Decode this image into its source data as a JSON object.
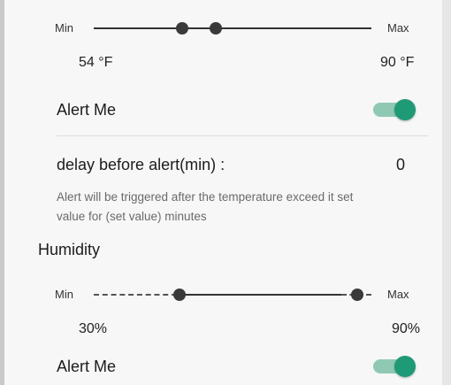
{
  "temperature": {
    "slider": {
      "min_label": "Min",
      "max_label": "Max",
      "low_fraction": 0.32,
      "high_fraction": 0.44
    },
    "min_value": "54 °F",
    "max_value": "90 °F",
    "alert_label": "Alert Me",
    "alert_on": true,
    "delay_label": "delay before alert(min) :",
    "delay_value": "0",
    "hint_line1": "Alert will be triggered after the temperature exceed it set",
    "hint_line2": "value for (set value) minutes"
  },
  "humidity": {
    "title": "Humidity",
    "slider": {
      "min_label": "Min",
      "max_label": "Max",
      "low_fraction": 0.31,
      "high_fraction": 0.95
    },
    "min_value": "30%",
    "max_value": "90%",
    "alert_label": "Alert Me",
    "alert_on": true
  },
  "colors": {
    "toggle_track": "#8fc9b4",
    "toggle_knob": "#1f9a76",
    "slider_thumb": "#3a3a3a"
  }
}
